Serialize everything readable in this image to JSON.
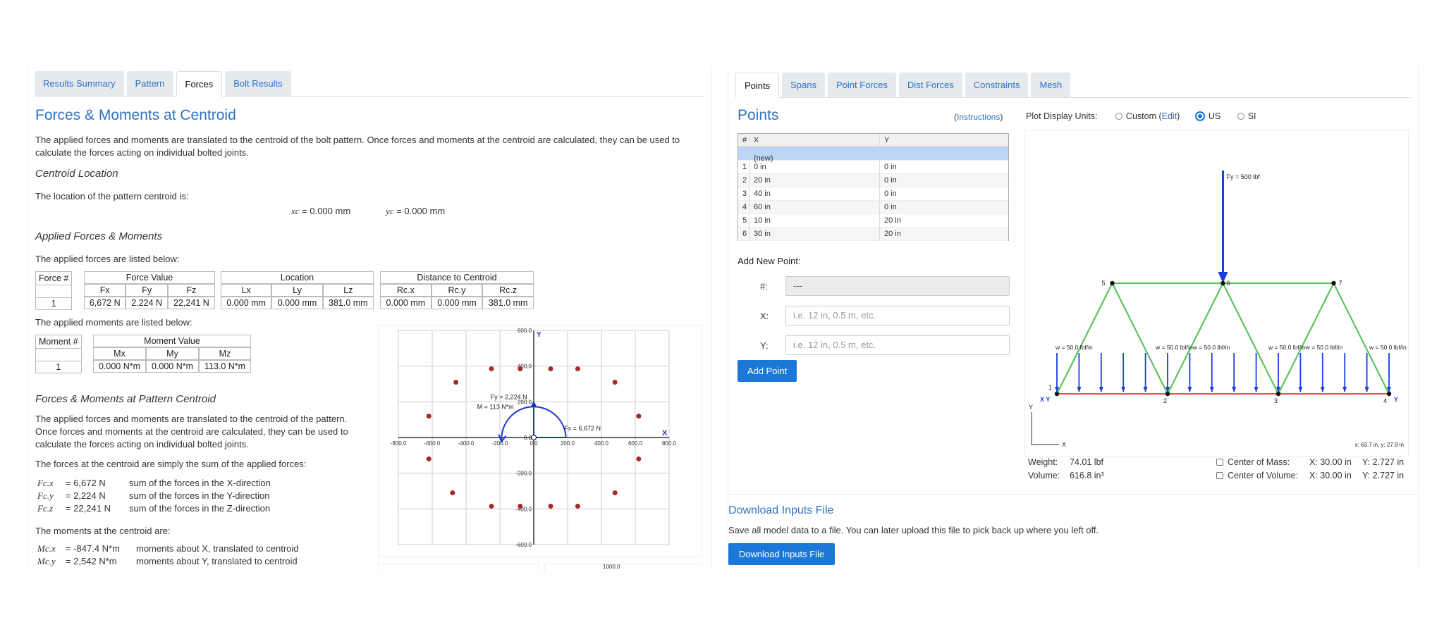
{
  "left": {
    "tabs": [
      "Results Summary",
      "Pattern",
      "Forces",
      "Bolt Results"
    ],
    "title": "Forces & Moments at Centroid",
    "intro": "The applied forces and moments are translated to the centroid of the bolt pattern. Once forces and moments at the centroid are calculated, they can be used to calculate the forces acting on individual bolted joints.",
    "centroid_heading": "Centroid Location",
    "centroid_text": "The location of the pattern centroid is:",
    "xc_label": "xc",
    "xc_value": "=  0.000 mm",
    "yc_label": "yc",
    "yc_value": "=  0.000 mm",
    "applied_heading": "Applied Forces & Moments",
    "forces_listed": "The applied forces are listed below:",
    "force_table": {
      "force_num": "Force #",
      "force_value": "Force Value",
      "location": "Location",
      "distance": "Distance to Centroid",
      "cols": [
        "Fx",
        "Fy",
        "Fz",
        "Lx",
        "Ly",
        "Lz",
        "Rc.x",
        "Rc.y",
        "Rc.z"
      ],
      "row_num": "1",
      "row": [
        "6,672 N",
        "2,224 N",
        "22,241 N",
        "0.000 mm",
        "0.000 mm",
        "381.0 mm",
        "0.000 mm",
        "0.000 mm",
        "381.0 mm"
      ]
    },
    "moments_listed": "The applied moments are listed below:",
    "moment_table": {
      "moment_num": "Moment #",
      "moment_value": "Moment Value",
      "cols": [
        "Mx",
        "My",
        "Mz"
      ],
      "row_num": "1",
      "row": [
        "0.000 N*m",
        "0.000 N*m",
        "113.0 N*m"
      ]
    },
    "pattern_heading": "Forces & Moments at Pattern Centroid",
    "pattern_text": "The applied forces and moments are translated to the centroid of the pattern. Once forces and moments at the centroid are calculated, they can be used to calculate the forces acting on individual bolted joints.",
    "sum_text": "The forces at the centroid are simply the sum of the applied forces:",
    "sums": [
      {
        "sym": "Fc.x",
        "val": "=  6,672 N",
        "desc": "sum of the forces in the X-direction"
      },
      {
        "sym": "Fc.y",
        "val": "=  2,224 N",
        "desc": "sum of the forces in the Y-direction"
      },
      {
        "sym": "Fc.z",
        "val": "=  22,241 N",
        "desc": "sum of the forces in the Z-direction"
      }
    ],
    "moments_centroid": "The moments at the centroid are:",
    "msums": [
      {
        "sym": "Mc.x",
        "val": "=  -847.4 N*m",
        "desc": "moments about X, translated to centroid"
      },
      {
        "sym": "Mc.y",
        "val": "=  2,542 N*m",
        "desc": "moments about Y, translated to centroid"
      }
    ],
    "plot": {
      "xticks": [
        "-800.0",
        "-600.0",
        "-400.0",
        "-200.0",
        "0.0",
        "200.0",
        "400.0",
        "600.0",
        "800.0"
      ],
      "yticks": [
        "600.0",
        "400.0",
        "200.0",
        "0.0",
        "-200.0",
        "-400.0",
        "-600.0"
      ],
      "x_axis": "X",
      "y_axis": "Y",
      "fy_label": "Fy = 2,224 N",
      "m_label": "M = 113 N*m",
      "fx_label": "Fx = 6,672 N",
      "bottom_tick": "1000.0",
      "bolts": [
        [
          -460,
          310
        ],
        [
          -250,
          385
        ],
        [
          -80,
          385
        ],
        [
          100,
          385
        ],
        [
          260,
          385
        ],
        [
          480,
          310
        ],
        [
          -620,
          120
        ],
        [
          620,
          120
        ],
        [
          -620,
          -120
        ],
        [
          620,
          -120
        ],
        [
          -480,
          -310
        ],
        [
          -250,
          -385
        ],
        [
          -80,
          -385
        ],
        [
          100,
          -385
        ],
        [
          260,
          -385
        ],
        [
          480,
          -310
        ]
      ],
      "bolt_color": "#a52a2a"
    }
  },
  "right": {
    "tabs": [
      "Points",
      "Spans",
      "Point Forces",
      "Dist Forces",
      "Constraints",
      "Mesh"
    ],
    "title": "Points",
    "instructions_open": "(",
    "instructions": "Instructions",
    "instructions_close": ")",
    "plot_units_label": "Plot Display Units:",
    "units_custom": "Custom (",
    "units_edit": "Edit",
    "units_custom_close": ")",
    "units_us": "US",
    "units_si": "SI",
    "grid_headers": [
      "#",
      "X",
      "Y"
    ],
    "grid_new": "(new)",
    "grid_rows": [
      [
        "1",
        "0 in",
        "0 in"
      ],
      [
        "2",
        "20 in",
        "0 in"
      ],
      [
        "3",
        "40 in",
        "0 in"
      ],
      [
        "4",
        "60 in",
        "0 in"
      ],
      [
        "5",
        "10 in",
        "20 in"
      ],
      [
        "6",
        "30 in",
        "20 in"
      ]
    ],
    "add_new_point": "Add New Point:",
    "num_label": "#:",
    "num_value": "---",
    "x_label": "X:",
    "x_placeholder": "i.e. 12 in, 0.5 m, etc.",
    "y_label": "Y:",
    "y_placeholder": "i.e. 12 in, 0.5 m, etc.",
    "add_point_button": "Add Point",
    "truss": {
      "force_label": "Fy = 500 lbf",
      "dist_labels": [
        "w = 50.0 lbf/in",
        "w = 50.0 lbf/inw = 50.0 lbf/in",
        "w = 50.0 lbf/inw = 50.0 lbf/in",
        "w = 50.0 lbf/in"
      ],
      "node_labels": [
        "1",
        "2",
        "3",
        "4",
        "5",
        "6",
        "7"
      ],
      "xy_left": "X Y",
      "y_right": "Y",
      "axis_x": "X",
      "axis_y": "Y",
      "cursor": "x: 63.7 in, y: 27.9 in",
      "member_color": "#5cc45c",
      "base_color": "#e05050",
      "arrow_color": "#1a3fe0"
    },
    "weight_label": "Weight:",
    "weight_value": "74.01 lbf",
    "volume_label": "Volume:",
    "volume_value": "616.8 in³",
    "com_label": "Center of Mass:",
    "com_x": "X: 30.00 in",
    "com_y": "Y: 2.727 in",
    "cov_label": "Center of Volume:",
    "cov_x": "X: 30.00 in",
    "cov_y": "Y: 2.727 in",
    "download_heading": "Download Inputs File",
    "download_text": "Save all model data to a file. You can later upload this file to pick back up where you left off.",
    "download_button": "Download Inputs File"
  }
}
